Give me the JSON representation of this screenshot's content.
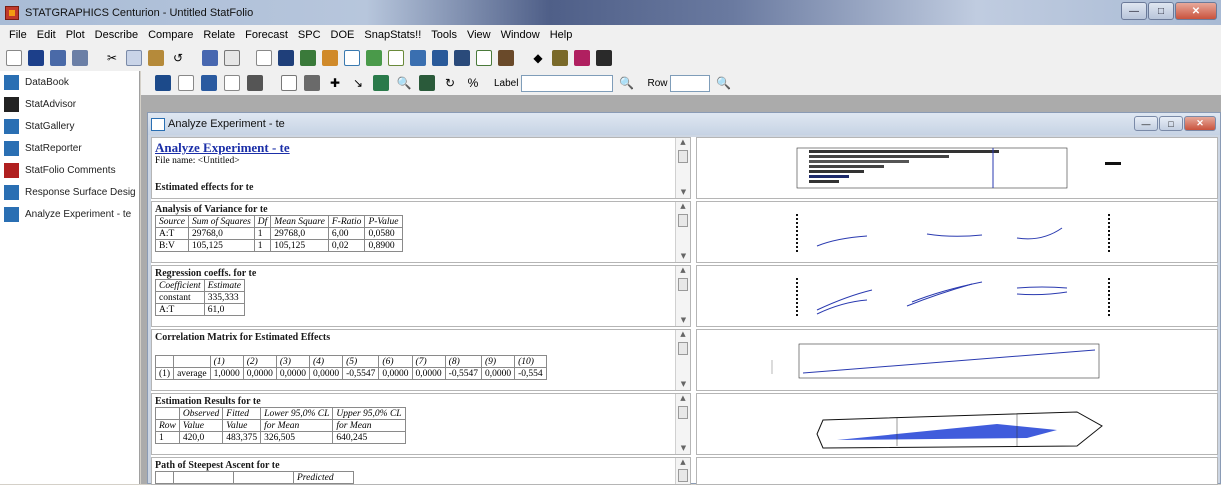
{
  "window": {
    "title": "STATGRAPHICS Centurion - Untitled StatFolio"
  },
  "menu": [
    "File",
    "Edit",
    "Plot",
    "Describe",
    "Compare",
    "Relate",
    "Forecast",
    "SPC",
    "DOE",
    "SnapStats!!",
    "Tools",
    "View",
    "Window",
    "Help"
  ],
  "sidebar": {
    "items": [
      {
        "label": "DataBook",
        "icon": "databook-icon",
        "color": "#2a6fb3"
      },
      {
        "label": "StatAdvisor",
        "icon": "statadvisor-icon",
        "color": "#222222"
      },
      {
        "label": "StatGallery",
        "icon": "statgallery-icon",
        "color": "#2a6fb3"
      },
      {
        "label": "StatReporter",
        "icon": "statreporter-icon",
        "color": "#2a6fb3"
      },
      {
        "label": "StatFolio Comments",
        "icon": "comments-icon",
        "color": "#b02020"
      },
      {
        "label": "Response Surface Desig",
        "icon": "response-surface-icon",
        "color": "#2a6fb3"
      },
      {
        "label": "Analyze Experiment - te",
        "icon": "analyze-experiment-icon",
        "color": "#2a6fb3"
      }
    ]
  },
  "toolbar2": {
    "label_caption": "Label",
    "row_caption": "Row"
  },
  "child": {
    "title": "Analyze Experiment - te"
  },
  "panes": {
    "header": {
      "title": "Analyze Experiment - te",
      "file": "File name: <Untitled>",
      "section": "Estimated effects for te"
    },
    "anova": {
      "title": "Analysis of Variance for te",
      "headers": [
        "Source",
        "Sum of Squares",
        "Df",
        "Mean Square",
        "F-Ratio",
        "P-Value"
      ],
      "rows": [
        [
          "A:T",
          "29768,0",
          "1",
          "29768,0",
          "6,00",
          "0,0580"
        ],
        [
          "B:V",
          "105,125",
          "1",
          "105,125",
          "0,02",
          "0,8900"
        ]
      ]
    },
    "regression": {
      "title": "Regression coeffs. for te",
      "headers": [
        "Coefficient",
        "Estimate"
      ],
      "rows": [
        [
          "constant",
          "335,333"
        ],
        [
          "A:T",
          "61,0"
        ]
      ]
    },
    "correlation": {
      "title": "Correlation Matrix for Estimated Effects",
      "headers": [
        "",
        "",
        "(1)",
        "(2)",
        "(3)",
        "(4)",
        "(5)",
        "(6)",
        "(7)",
        "(8)",
        "(9)",
        "(10)"
      ],
      "rows": [
        [
          "(1)",
          "average",
          "1,0000",
          "0,0000",
          "0,0000",
          "0,0000",
          "-0,5547",
          "0,0000",
          "0,0000",
          "-0,5547",
          "0,0000",
          "-0,554"
        ]
      ]
    },
    "estimation": {
      "title": "Estimation Results for te",
      "h1": [
        "",
        "Observed",
        "Fitted",
        "Lower 95,0% CL",
        "Upper 95,0% CL"
      ],
      "h2": [
        "Row",
        "Value",
        "Value",
        "for Mean",
        "for Mean"
      ],
      "rows": [
        [
          "1",
          "420,0",
          "483,375",
          "326,505",
          "640,245"
        ]
      ]
    },
    "steepest": {
      "title": "Path of Steepest Ascent for te",
      "h1": "Predicted"
    }
  }
}
